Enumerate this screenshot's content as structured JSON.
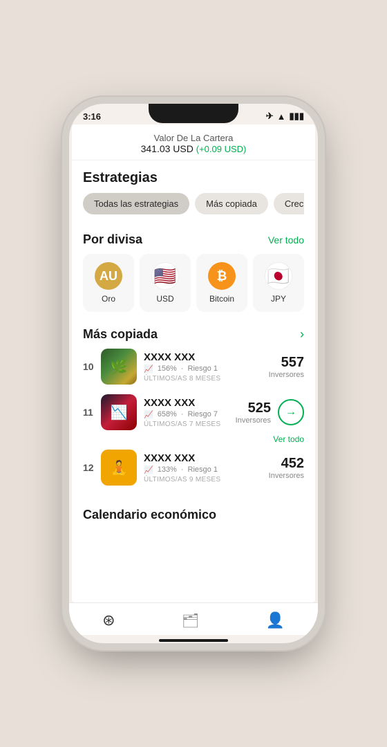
{
  "statusBar": {
    "time": "3:16"
  },
  "header": {
    "title": "Valor De La Cartera",
    "amount": "341.03 USD",
    "change": "(+0.09 USD)"
  },
  "estrategias": {
    "sectionTitle": "Estrategias",
    "pills": [
      {
        "label": "Todas las estrategias",
        "active": true
      },
      {
        "label": "Más copiada",
        "active": false
      },
      {
        "label": "Crecimient…",
        "active": false
      }
    ]
  },
  "porDivisa": {
    "sectionTitle": "Por divisa",
    "verTodo": "Ver todo",
    "items": [
      {
        "id": "oro",
        "label": "Oro",
        "iconType": "gold",
        "symbol": "AU"
      },
      {
        "id": "usd",
        "label": "USD",
        "iconType": "usd",
        "symbol": "🇺🇸"
      },
      {
        "id": "btc",
        "label": "Bitcoin",
        "iconType": "btc",
        "symbol": "₿"
      },
      {
        "id": "jpy",
        "label": "JPY",
        "iconType": "jpy",
        "symbol": "🇯🇵"
      }
    ]
  },
  "masCopiada": {
    "sectionTitle": "Más copiada",
    "verTodo": "Ver todo",
    "items": [
      {
        "rank": "10",
        "name": "XXXX XXX",
        "returnPct": "156%",
        "risk": "Riesgo 1",
        "period": "Últimos/as 8 meses",
        "investors": "557",
        "investorsLabel": "Inversores",
        "thumbClass": "thumb-1"
      },
      {
        "rank": "11",
        "name": "XXXX XXX",
        "returnPct": "658%",
        "risk": "Riesgo 7",
        "period": "Últimos/as 7 meses",
        "investors": "525",
        "investorsLabel": "Inversores",
        "thumbClass": "thumb-2",
        "hasArrow": true
      },
      {
        "rank": "12",
        "name": "XXXX XXX",
        "returnPct": "133%",
        "risk": "Riesgo 1",
        "period": "Últimos/as 9 meses",
        "investors": "452",
        "investorsLabel": "Inversores",
        "thumbClass": "thumb-3"
      }
    ]
  },
  "calendarioEconomico": {
    "sectionTitle": "Calendario económico"
  },
  "bottomNav": {
    "items": [
      {
        "id": "home",
        "icon": "⊕",
        "label": ""
      },
      {
        "id": "portfolio",
        "icon": "💼",
        "label": ""
      },
      {
        "id": "profile",
        "icon": "👤",
        "label": ""
      }
    ]
  }
}
